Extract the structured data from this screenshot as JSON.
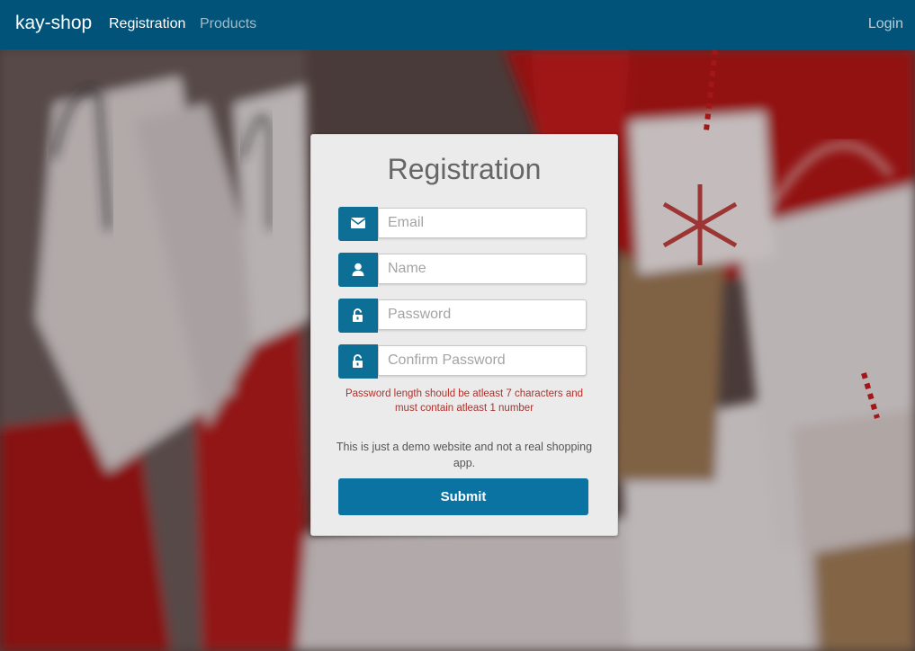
{
  "navbar": {
    "brand": "kay-shop",
    "links": [
      {
        "label": "Registration",
        "active": true
      },
      {
        "label": "Products",
        "active": false
      }
    ],
    "login_label": "Login",
    "bg_color": "#025379"
  },
  "form": {
    "title": "Registration",
    "fields": [
      {
        "icon": "envelope-icon",
        "placeholder": "Email",
        "value": ""
      },
      {
        "icon": "user-icon",
        "placeholder": "Name",
        "value": ""
      },
      {
        "icon": "unlock-icon",
        "placeholder": "Password",
        "value": ""
      },
      {
        "icon": "unlock-icon",
        "placeholder": "Confirm Password",
        "value": ""
      }
    ],
    "error_message": "Password length should be atleast 7 characters and must contain atleast 1 number",
    "note": "This is just a demo website and not a real shopping app.",
    "submit_label": "Submit",
    "accent_color": "#0d6e96",
    "error_color": "#b0302a"
  }
}
